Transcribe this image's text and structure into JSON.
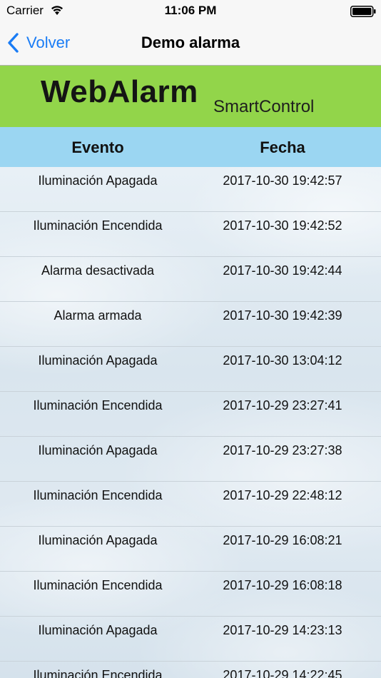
{
  "status_bar": {
    "carrier": "Carrier",
    "time": "11:06 PM",
    "wifi_icon": "wifi-icon",
    "battery_icon": "battery-icon"
  },
  "nav": {
    "back_label": "Volver",
    "back_icon": "chevron-left-icon",
    "title": "Demo alarma",
    "accent_color": "#1a7cf5"
  },
  "banner": {
    "logo_main": "WebAlarm",
    "logo_sub": "SmartControl",
    "background_color": "#92d54a"
  },
  "table": {
    "header_color": "#9bd6f2",
    "columns": [
      "Evento",
      "Fecha"
    ],
    "rows": [
      {
        "evento": "Iluminación Apagada",
        "fecha": "2017-10-30 19:42:57"
      },
      {
        "evento": "Iluminación Encendida",
        "fecha": "2017-10-30 19:42:52"
      },
      {
        "evento": "Alarma desactivada",
        "fecha": "2017-10-30 19:42:44"
      },
      {
        "evento": "Alarma armada",
        "fecha": "2017-10-30 19:42:39"
      },
      {
        "evento": "Iluminación Apagada",
        "fecha": "2017-10-30 13:04:12"
      },
      {
        "evento": "Iluminación Encendida",
        "fecha": "2017-10-29 23:27:41"
      },
      {
        "evento": "Iluminación Apagada",
        "fecha": "2017-10-29 23:27:38"
      },
      {
        "evento": "Iluminación Encendida",
        "fecha": "2017-10-29 22:48:12"
      },
      {
        "evento": "Iluminación Apagada",
        "fecha": "2017-10-29 16:08:21"
      },
      {
        "evento": "Iluminación Encendida",
        "fecha": "2017-10-29 16:08:18"
      },
      {
        "evento": "Iluminación Apagada",
        "fecha": "2017-10-29 14:23:13"
      },
      {
        "evento": "Iluminación Encendida",
        "fecha": "2017-10-29 14:22:45"
      }
    ]
  }
}
